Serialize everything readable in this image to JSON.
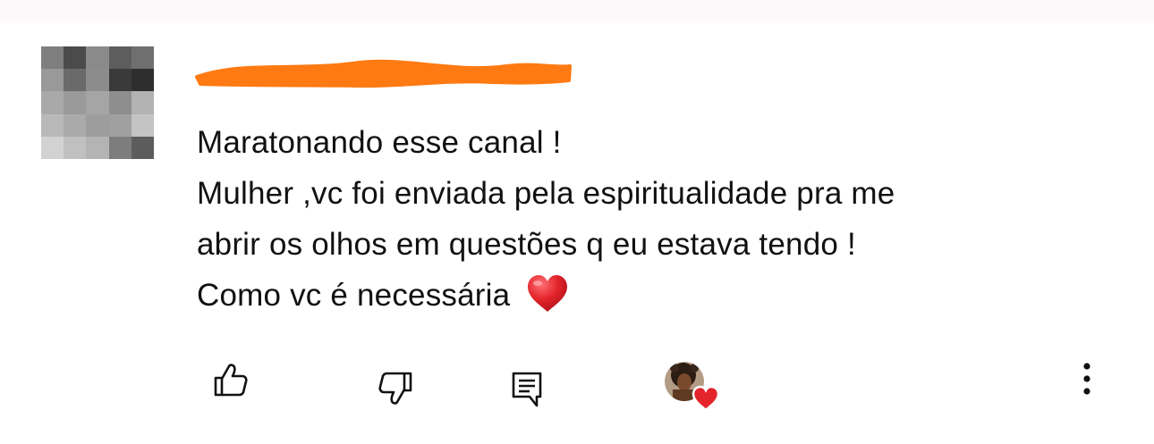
{
  "comment": {
    "author_avatar": {
      "icon": "pixelated-avatar",
      "pixels": [
        "#7f7f7f",
        "#4b4b4b",
        "#8a8a8a",
        "#5d5d5d",
        "#6f6f6f",
        "#999999",
        "#6a6a6a",
        "#8c8c8c",
        "#3a3a3a",
        "#2e2e2e",
        "#a9a9a9",
        "#9a9a9a",
        "#a5a5a5",
        "#8e8e8e",
        "#b3b3b3",
        "#b9b9b9",
        "#aaaaaa",
        "#9d9d9d",
        "#a0a0a0",
        "#c4c4c4",
        "#d2d2d2",
        "#c0c0c0",
        "#b4b4b4",
        "#7d7d7d",
        "#5c5c5c"
      ]
    },
    "author_name_redaction_color": "#ff7a12",
    "lines": [
      "Maratonando esse canal !",
      "Mulher ,vc foi enviada pela espiritualidade  pra me",
      "abrir os olhos em questões q eu estava tendo !",
      "Como vc é necessária"
    ],
    "emoji": "red-heart-emoji"
  },
  "actions": {
    "like_icon": "thumbs-up-icon",
    "dislike_icon": "thumbs-down-icon",
    "reply_icon": "reply-comment-icon",
    "creator_heart_icon": "creator-heart-icon",
    "more_icon": "more-vertical-icon"
  },
  "colors": {
    "text": "#111111",
    "icon": "#111111",
    "heart_red": "#e3242b"
  }
}
